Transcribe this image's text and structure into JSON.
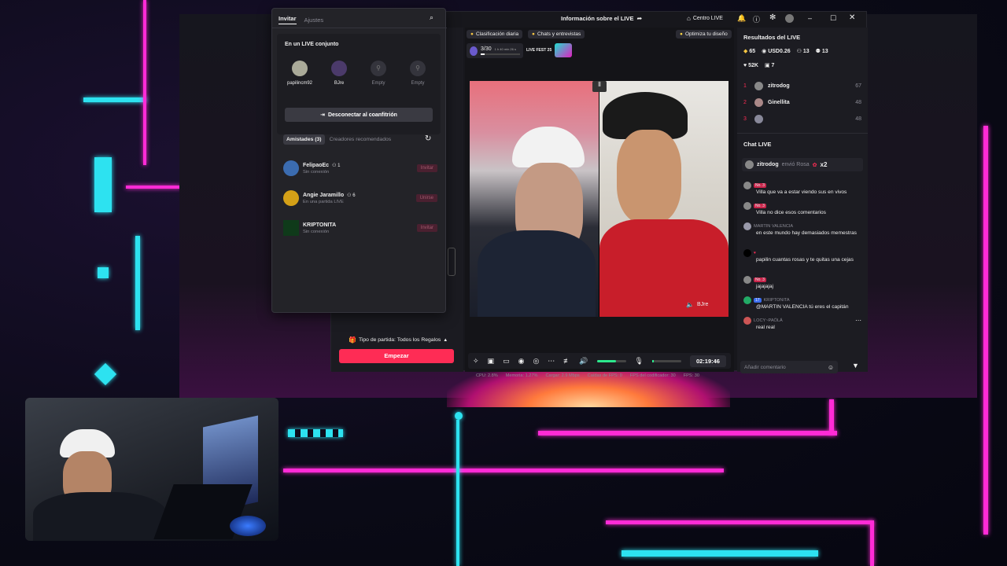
{
  "popup": {
    "tabs": [
      "Invitar",
      "Ajustes"
    ],
    "section_title": "En un LIVE conjunto",
    "slots": [
      {
        "name": "papilincm92"
      },
      {
        "name": "BJre"
      },
      {
        "name": "Empty"
      },
      {
        "name": "Empty"
      }
    ],
    "disconnect_label": "Desconectar al coanfitrión",
    "list_tabs": [
      "Amistades (3)",
      "Creadores recomendados"
    ],
    "friends": [
      {
        "name": "FelipaoEc",
        "badge": "1",
        "status": "Sin conexión",
        "action": "Invitar"
      },
      {
        "name": "Angie Jaramillo",
        "badge": "6",
        "status": "En una partida LIVE",
        "action": "Unirse"
      },
      {
        "name": "KRIPTONITA",
        "badge": "",
        "status": "Sin conexión",
        "action": "Invitar"
      }
    ]
  },
  "titlebar": {
    "center_title": "Información sobre el LIVE",
    "centro": "Centro LIVE"
  },
  "center": {
    "tags": [
      "Clasificación diaria",
      "Chats y entrevistas"
    ],
    "optimize": "Optimiza tu diseño",
    "progress_count": "3/30",
    "progress_sub": "1 h 40 min 26 s",
    "fest": "LIVE FEST 25",
    "guest_name": "BJre",
    "match_label": "Tipo de partida: Todos los Regalos",
    "start_label": "Empezar",
    "timer": "02:19:46",
    "stats": [
      {
        "label": "CPU:",
        "value": "2.8%"
      },
      {
        "label": "Memoria:",
        "value": "1.27%"
      },
      {
        "label": "Cargar:",
        "value": "2.9 Mbps"
      },
      {
        "label": "Caídas de FPS:",
        "value": "0"
      },
      {
        "label": "FPS del codificador:",
        "value": "30"
      },
      {
        "label": "FPS:",
        "value": "30"
      }
    ]
  },
  "results": {
    "title": "Resultados del LIVE",
    "metrics": [
      {
        "icon": "diamond-icon",
        "value": "65"
      },
      {
        "icon": "dollar-icon",
        "value": "USD0.26"
      },
      {
        "icon": "users-icon",
        "value": "13"
      },
      {
        "icon": "person-plus-icon",
        "value": "13"
      },
      {
        "icon": "heart-icon",
        "value": "52K"
      },
      {
        "icon": "gift-icon",
        "value": "7"
      }
    ],
    "ranking": [
      {
        "rank": "1",
        "name": "zitrodog",
        "score": "67"
      },
      {
        "rank": "2",
        "name": "Ginellita",
        "score": "48"
      },
      {
        "rank": "3",
        "name": "",
        "score": "48"
      }
    ]
  },
  "chat": {
    "title": "Chat LIVE",
    "gift": {
      "name": "zitrodog",
      "text": "envió Rosa",
      "count": "x2"
    },
    "messages": [
      {
        "user": "",
        "badge": "No. 3",
        "text": "Villa que va a estar viendo sus en vivos"
      },
      {
        "user": "",
        "badge": "No. 3",
        "text": "Villa no dice esos comentarios"
      },
      {
        "user": "MARTIN VALENCIA",
        "badge": "",
        "text": "en este mundo hay demasiados memestras"
      },
      {
        "user": "",
        "badge": "",
        "text": "papilin cuantas rosas y te quitas una cejas"
      },
      {
        "user": "",
        "badge": "No. 3",
        "text": "jajajajaj"
      },
      {
        "user": "KRIPTONITA",
        "badge": "17",
        "text": "@MARTIN VALENCIA tú eres el capitán"
      },
      {
        "user": "LOCY~PAÖLÁ",
        "badge": "",
        "text": "real real"
      }
    ],
    "input_placeholder": "Añadir comentario"
  }
}
